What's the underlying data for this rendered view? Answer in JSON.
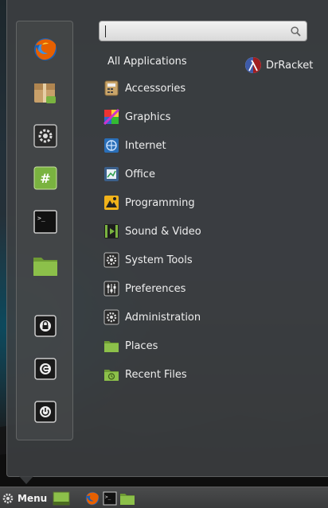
{
  "search": {
    "value": "",
    "placeholder": ""
  },
  "all_applications_label": "All Applications",
  "categories": [
    {
      "label": "Accessories",
      "icon": "accessories-icon"
    },
    {
      "label": "Graphics",
      "icon": "graphics-icon"
    },
    {
      "label": "Internet",
      "icon": "internet-icon"
    },
    {
      "label": "Office",
      "icon": "office-icon"
    },
    {
      "label": "Programming",
      "icon": "programming-icon"
    },
    {
      "label": "Sound & Video",
      "icon": "sound-video-icon"
    },
    {
      "label": "System Tools",
      "icon": "system-tools-icon"
    },
    {
      "label": "Preferences",
      "icon": "preferences-icon"
    },
    {
      "label": "Administration",
      "icon": "administration-icon"
    },
    {
      "label": "Places",
      "icon": "places-icon"
    },
    {
      "label": "Recent Files",
      "icon": "recent-files-icon"
    }
  ],
  "applications": [
    {
      "label": "DrRacket",
      "icon": "drracket-icon"
    }
  ],
  "favorites": [
    "firefox-icon",
    "software-manager-icon",
    "system-settings-icon",
    "terminal-icon-green",
    "terminal-icon",
    "files-folder-icon",
    "lock-screen-icon",
    "logout-icon",
    "shutdown-icon"
  ],
  "taskbar": {
    "menu_label": "Menu"
  },
  "colors": {
    "panel": "#3e4042",
    "accent_green": "#7ab340",
    "firefox_orange": "#e66000"
  }
}
